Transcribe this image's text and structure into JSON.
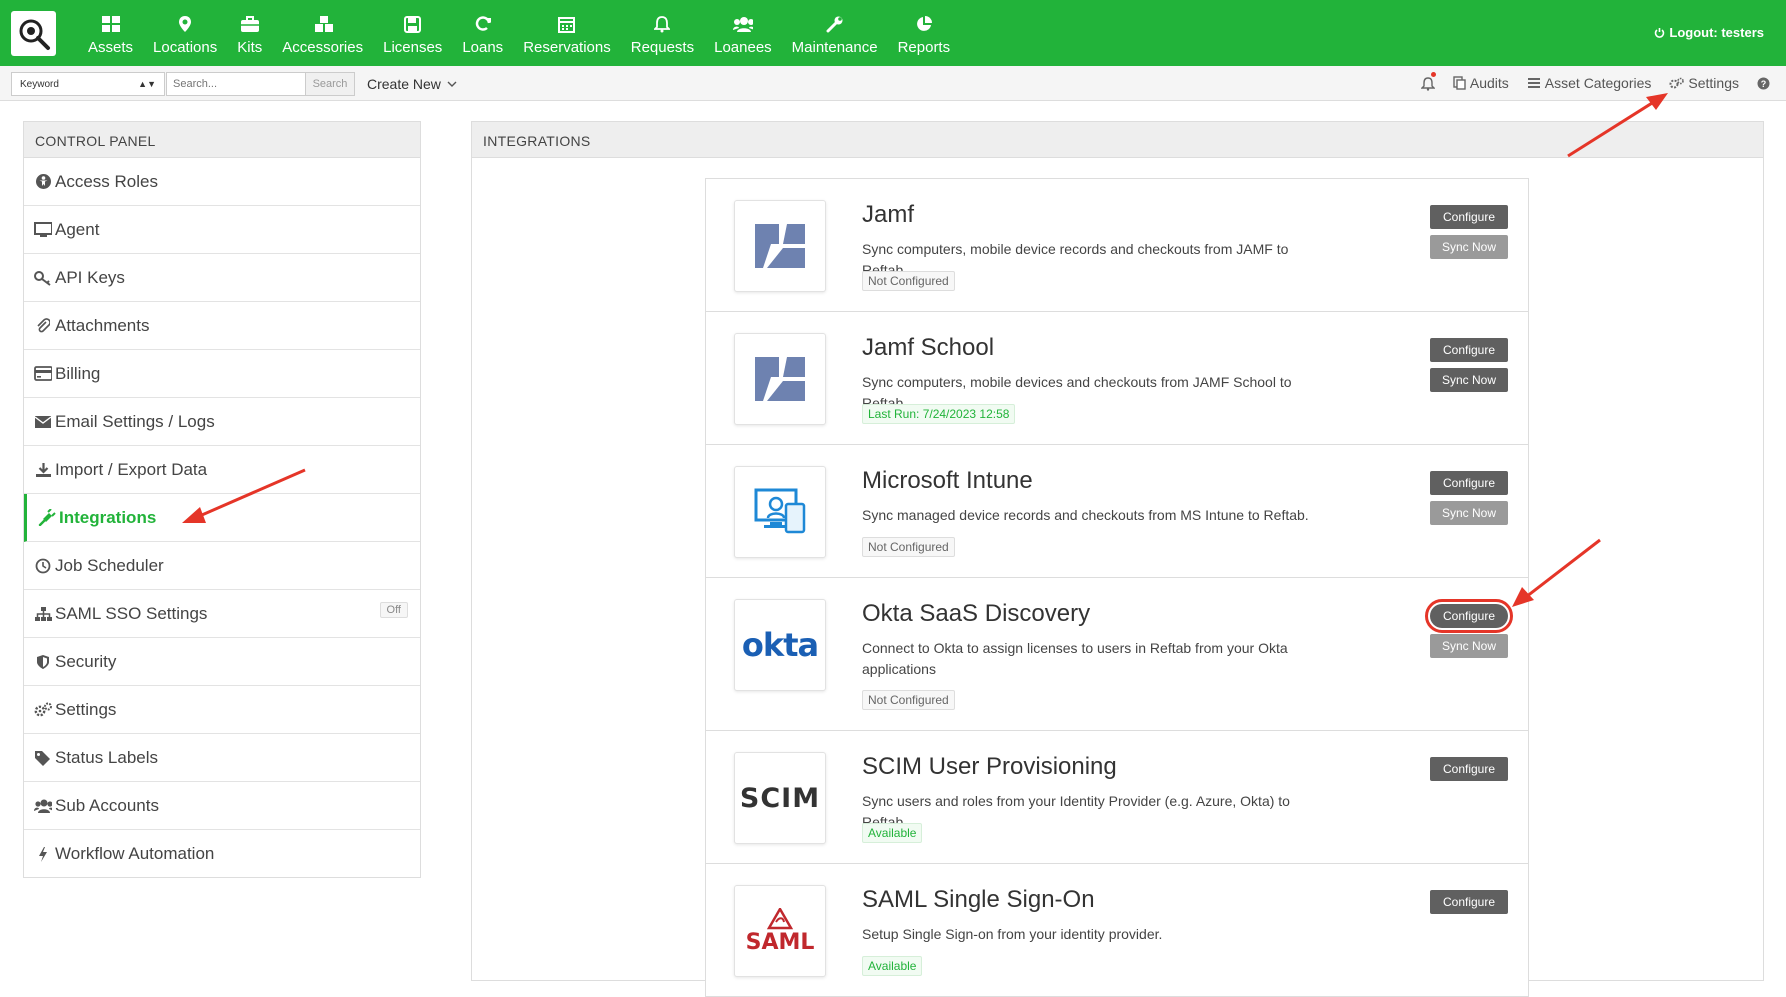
{
  "topnav": {
    "items": [
      {
        "label": "Assets",
        "icon": "assets-icon"
      },
      {
        "label": "Locations",
        "icon": "location-pin-icon"
      },
      {
        "label": "Kits",
        "icon": "briefcase-icon"
      },
      {
        "label": "Accessories",
        "icon": "cubes-icon"
      },
      {
        "label": "Licenses",
        "icon": "floppy-disk-icon"
      },
      {
        "label": "Loans",
        "icon": "refresh-icon"
      },
      {
        "label": "Reservations",
        "icon": "calendar-icon"
      },
      {
        "label": "Requests",
        "icon": "bell-icon"
      },
      {
        "label": "Loanees",
        "icon": "users-icon"
      },
      {
        "label": "Maintenance",
        "icon": "wrench-icon"
      },
      {
        "label": "Reports",
        "icon": "pie-chart-icon"
      }
    ],
    "logout": "Logout: testers",
    "accent": "#22b33a"
  },
  "subbar": {
    "keyword": "Keyword",
    "search_placeholder": "Search...",
    "search_button": "Search",
    "create_new": "Create New",
    "audits": "Audits",
    "asset_categories": "Asset Categories",
    "settings": "Settings"
  },
  "control_panel": {
    "title": "CONTROL PANEL",
    "items": [
      {
        "label": "Access Roles",
        "icon": "access-roles-icon"
      },
      {
        "label": "Agent",
        "icon": "monitor-icon"
      },
      {
        "label": "API Keys",
        "icon": "key-icon"
      },
      {
        "label": "Attachments",
        "icon": "paperclip-icon"
      },
      {
        "label": "Billing",
        "icon": "credit-card-icon"
      },
      {
        "label": "Email Settings / Logs",
        "icon": "envelope-icon"
      },
      {
        "label": "Import / Export Data",
        "icon": "download-icon"
      },
      {
        "label": "Integrations",
        "icon": "plug-icon"
      },
      {
        "label": "Job Scheduler",
        "icon": "clock-icon"
      },
      {
        "label": "SAML SSO Settings",
        "icon": "sitemap-icon"
      },
      {
        "label": "Security",
        "icon": "shield-icon"
      },
      {
        "label": "Settings",
        "icon": "gears-icon"
      },
      {
        "label": "Status Labels",
        "icon": "tags-icon"
      },
      {
        "label": "Sub Accounts",
        "icon": "users-icon"
      },
      {
        "label": "Workflow Automation",
        "icon": "bolt-icon"
      }
    ],
    "saml_badge": "Off"
  },
  "integrations": {
    "title": "INTEGRATIONS",
    "cards": [
      {
        "title": "Jamf",
        "desc": "Sync computers, mobile device records and checkouts from JAMF to Reftab.",
        "status": "Not Configured",
        "configure": "Configure",
        "sync": "Sync Now"
      },
      {
        "title": "Jamf School",
        "desc": "Sync computers, mobile devices and checkouts from JAMF School to Reftab.",
        "status": "Last Run: 7/24/2023 12:58",
        "configure": "Configure",
        "sync": "Sync Now"
      },
      {
        "title": "Microsoft Intune",
        "desc": "Sync managed device records and checkouts from MS Intune to Reftab.",
        "status": "Not Configured",
        "configure": "Configure",
        "sync": "Sync Now"
      },
      {
        "title": "Okta SaaS Discovery",
        "desc": "Connect to Okta to assign licenses to users in Reftab from your Okta applications",
        "status": "Not Configured",
        "configure": "Configure",
        "sync": "Sync Now",
        "logo_text": "okta"
      },
      {
        "title": "SCIM User Provisioning",
        "desc": "Sync users and roles from your Identity Provider (e.g. Azure, Okta) to Reftab",
        "status": "Available",
        "configure": "Configure",
        "logo_text": "SCIM"
      },
      {
        "title": "SAML Single Sign-On",
        "desc": "Setup Single Sign-on from your identity provider.",
        "status": "Available",
        "configure": "Configure",
        "logo_text": "SAML"
      }
    ]
  }
}
